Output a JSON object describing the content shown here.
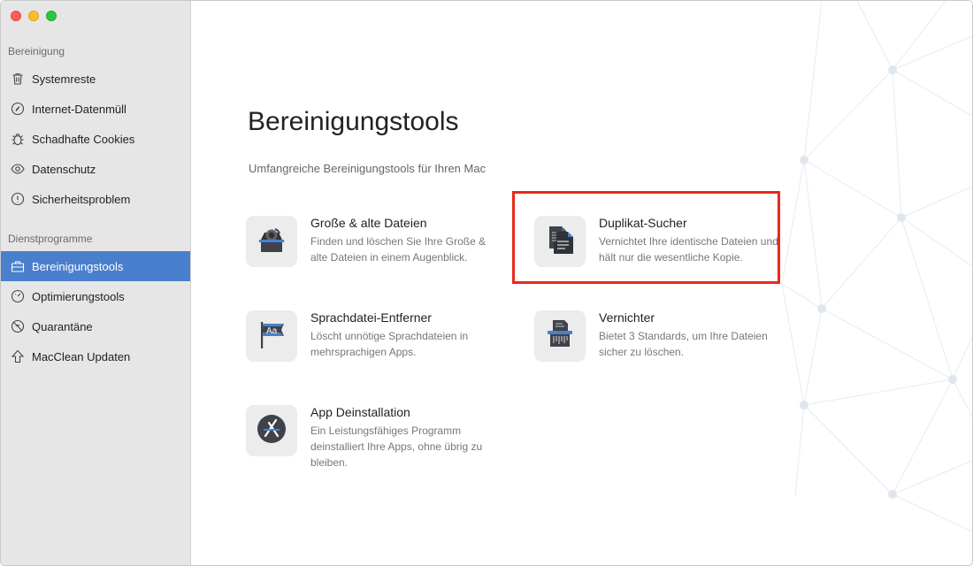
{
  "sidebar": {
    "section_cleanup": "Bereinigung",
    "section_utilities": "Dienstprogramme",
    "items": [
      {
        "label": "Systemreste",
        "icon": "trash-icon"
      },
      {
        "label": "Internet-Datenmüll",
        "icon": "compass-icon"
      },
      {
        "label": "Schadhafte Cookies",
        "icon": "bug-icon"
      },
      {
        "label": "Datenschutz",
        "icon": "eye-icon"
      },
      {
        "label": "Sicherheitsproblem",
        "icon": "shield-icon"
      },
      {
        "label": "Bereinigungstools",
        "icon": "toolbox-icon",
        "active": true
      },
      {
        "label": "Optimierungstools",
        "icon": "gauge-icon"
      },
      {
        "label": "Quarantäne",
        "icon": "blocked-icon"
      },
      {
        "label": "MacClean Updaten",
        "icon": "arrow-up-icon"
      }
    ]
  },
  "main": {
    "title": "Bereinigungstools",
    "subtitle": "Umfangreiche Bereinigungstools für Ihren Mac",
    "tools": [
      {
        "name": "Große & alte Dateien",
        "desc": "Finden und löschen Sie Ihre Große & alte Dateien in einem Augenblick.",
        "icon": "large-old-files-icon"
      },
      {
        "name": "Duplikat-Sucher",
        "desc": "Vernichtet Ihre identische Dateien und hält nur die wesentliche Kopie.",
        "icon": "duplicate-documents-icon"
      },
      {
        "name": "Sprachdatei-Entferner",
        "desc": "Löscht unnötige Sprachdateien in mehrsprachigen Apps.",
        "icon": "language-flag-icon"
      },
      {
        "name": "Vernichter",
        "desc": "Bietet 3 Standards, um Ihre Dateien sicher zu löschen.",
        "icon": "shredder-icon"
      },
      {
        "name": "App Deinstallation",
        "desc": "Ein Leistungsfähiges Programm deinstalliert Ihre Apps, ohne übrig zu bleiben.",
        "icon": "app-uninstall-icon"
      }
    ]
  },
  "colors": {
    "accent": "#4a7fcd",
    "highlight": "#e8291c"
  }
}
